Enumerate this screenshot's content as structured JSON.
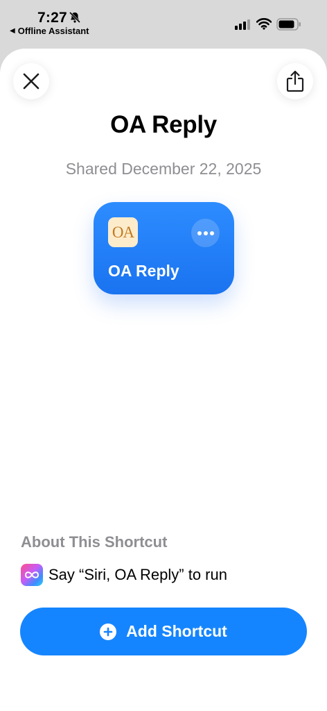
{
  "status_bar": {
    "time": "7:27",
    "back_app": "Offline Assistant",
    "icons": [
      "bell-slash-icon",
      "cellular-signal-icon",
      "wifi-icon",
      "battery-icon"
    ]
  },
  "header": {
    "close_icon": "close-icon",
    "share_icon": "share-icon"
  },
  "shortcut": {
    "title": "OA Reply",
    "shared_date": "Shared December 22, 2025",
    "card": {
      "app_icon_text": "OA",
      "label": "OA Reply",
      "more_icon": "ellipsis-icon",
      "color": "#1a7cf5"
    }
  },
  "about": {
    "heading": "About This Shortcut",
    "siri_text": "Say “Siri, OA Reply” to run"
  },
  "actions": {
    "add_label": "Add Shortcut",
    "add_color": "#1585ff"
  }
}
